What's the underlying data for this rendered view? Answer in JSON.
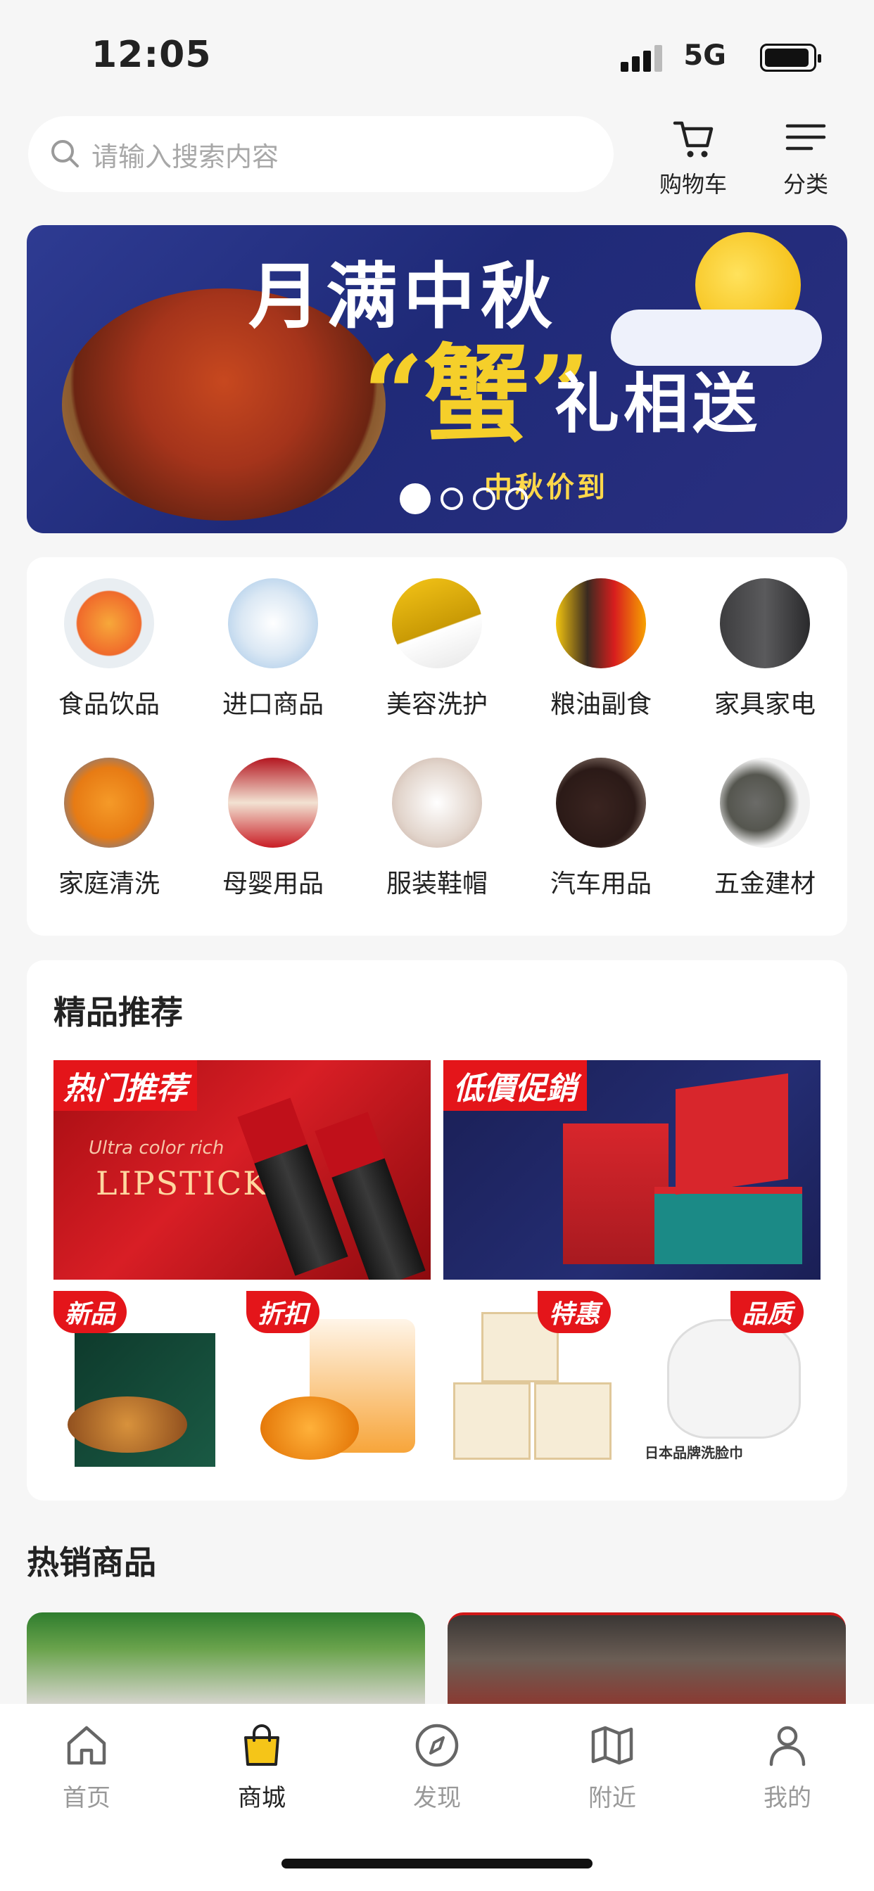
{
  "status_bar": {
    "time": "12:05",
    "network": "5G"
  },
  "search": {
    "placeholder": "请输入搜索内容"
  },
  "header": {
    "cart_label": "购物车",
    "category_label": "分类"
  },
  "banner": {
    "line1": "月满中秋",
    "line2": "“蟹”",
    "line3": "礼相送",
    "line4": "中秋价到",
    "page_count": 4,
    "active_index": 0
  },
  "categories": [
    {
      "label": "食品饮品",
      "icon": "drinks-image"
    },
    {
      "label": "进口商品",
      "icon": "imported-goods-image"
    },
    {
      "label": "美容洗护",
      "icon": "beauty-image"
    },
    {
      "label": "粮油副食",
      "icon": "grain-oil-image"
    },
    {
      "label": "家具家电",
      "icon": "appliance-image"
    },
    {
      "label": "家庭清洗",
      "icon": "cleaning-image"
    },
    {
      "label": "母婴用品",
      "icon": "baby-image"
    },
    {
      "label": "服装鞋帽",
      "icon": "clothing-image"
    },
    {
      "label": "汽车用品",
      "icon": "car-image"
    },
    {
      "label": "五金建材",
      "icon": "hardware-image"
    }
  ],
  "recommend": {
    "title": "精品推荐",
    "hot_tag": "热门推荐",
    "hot_sub": "Ultra color rich",
    "hot_main": "LIPSTICK",
    "sale_tag": "低價促銷",
    "small_tags": [
      "新品",
      "折扣",
      "特惠",
      "品质"
    ],
    "small_caption": "日本品牌洗脸巾"
  },
  "hot_section": {
    "title": "热销商品"
  },
  "tabbar": {
    "items": [
      {
        "label": "首页",
        "icon": "home-icon",
        "active": false
      },
      {
        "label": "商城",
        "icon": "shopping-bag-icon",
        "active": true
      },
      {
        "label": "发现",
        "icon": "compass-icon",
        "active": false
      },
      {
        "label": "附近",
        "icon": "map-icon",
        "active": false
      },
      {
        "label": "我的",
        "icon": "profile-icon",
        "active": false
      }
    ]
  },
  "colors": {
    "accent": "#f5c518",
    "tag_red": "#e4151a",
    "banner_blue": "#25308a"
  }
}
